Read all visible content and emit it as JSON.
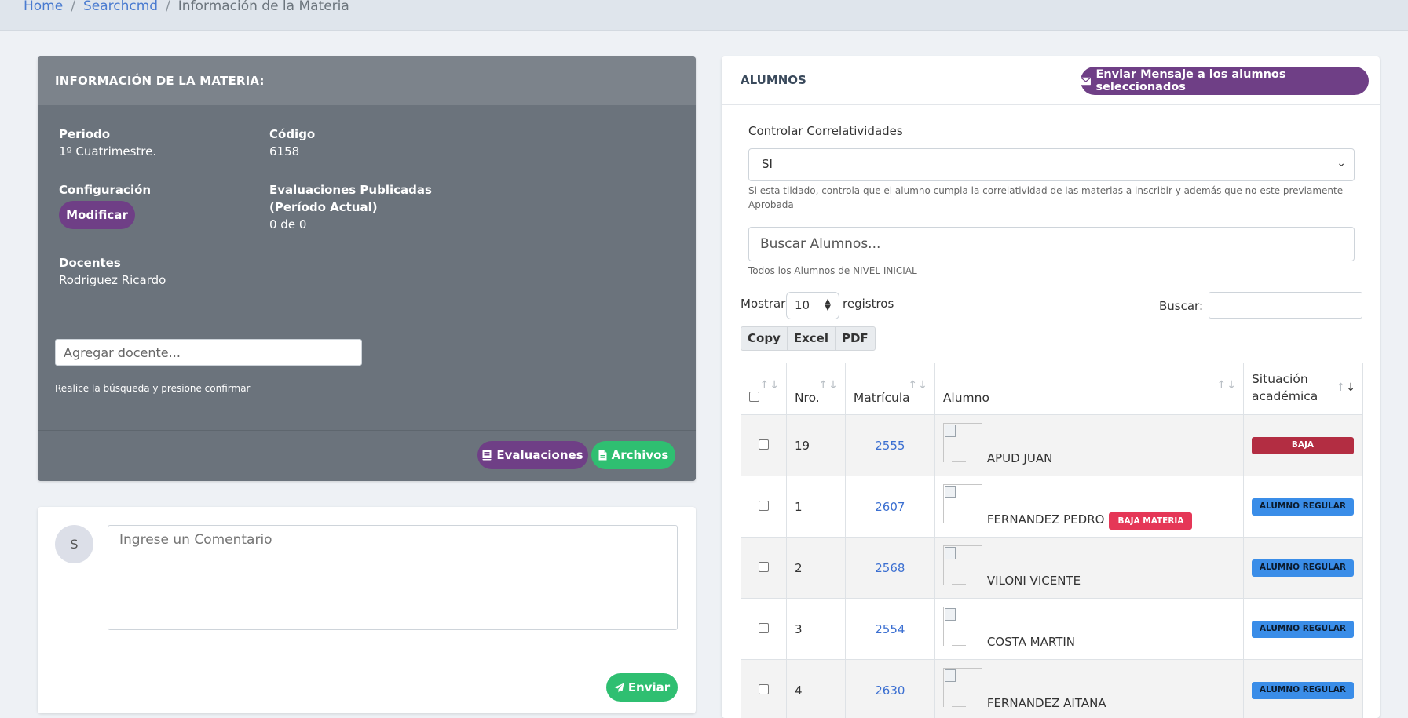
{
  "breadcrumb": {
    "home": "Home",
    "searchcmd": "Searchcmd",
    "current": "Información de la Materia",
    "sep": "/"
  },
  "materia": {
    "header": "INFORMACIÓN DE LA MATERIA:",
    "periodo_label": "Periodo",
    "periodo_value": "1º Cuatrimestre.",
    "codigo_label": "Código",
    "codigo_value": "6158",
    "config_label": "Configuración",
    "modificar_label": "Modificar",
    "eval_label_1": "Evaluaciones Publicadas",
    "eval_label_2": "(Período Actual)",
    "eval_value": "0 de 0",
    "docentes_label": "Docentes",
    "docentes_value": "Rodriguez Ricardo",
    "add_docente_placeholder": "Agregar docente...",
    "add_docente_hint": "Realice la búsqueda y presione confirmar",
    "evaluaciones_button": "Evaluaciones",
    "archivos_button": "Archivos"
  },
  "comment": {
    "avatar_initial": "S",
    "placeholder": "Ingrese un Comentario",
    "send_button": "Enviar"
  },
  "alumnos": {
    "title": "ALUMNOS",
    "send_message_button": "Enviar Mensaje a los alumnos seleccionados",
    "correlatividades_label": "Controlar Correlatividades",
    "correlatividades_value": "SI",
    "correlatividades_note_1": "Si esta tildado, controla que el alumno cumpla la correlatividad de las materias a inscribir y además que no este previamente",
    "correlatividades_note_2": "Aprobada",
    "search_placeholder": "Buscar Alumnos...",
    "search_note": "Todos los Alumnos de NIVEL INICIAL",
    "mostrar_label": "Mostrar",
    "length_value": "10",
    "registros_label": "registros",
    "buscar_label": "Buscar:",
    "export_buttons": [
      "Copy",
      "Excel",
      "PDF"
    ],
    "columns": {
      "nro": "Nro.",
      "matricula": "Matrícula",
      "alumno": "Alumno",
      "situacion_1": "Situación",
      "situacion_2": "académica"
    },
    "rows": [
      {
        "nro": "19",
        "matricula": "2555",
        "name": "APUD JUAN",
        "inline_badge": "",
        "status": "BAJA"
      },
      {
        "nro": "1",
        "matricula": "2607",
        "name": "FERNANDEZ PEDRO",
        "inline_badge": "BAJA MATERIA",
        "status": "ALUMNO REGULAR"
      },
      {
        "nro": "2",
        "matricula": "2568",
        "name": "VILONI VICENTE",
        "inline_badge": "",
        "status": "ALUMNO REGULAR"
      },
      {
        "nro": "3",
        "matricula": "2554",
        "name": "COSTA MARTIN",
        "inline_badge": "",
        "status": "ALUMNO REGULAR"
      },
      {
        "nro": "4",
        "matricula": "2630",
        "name": "FERNANDEZ AITANA",
        "inline_badge": "",
        "status": "ALUMNO REGULAR"
      }
    ]
  },
  "colors": {
    "purple": "#6f3f86",
    "green": "#2fbf71",
    "baja": "#b32d42",
    "regular": "#3a8de8",
    "baja_materia": "#e53757"
  }
}
